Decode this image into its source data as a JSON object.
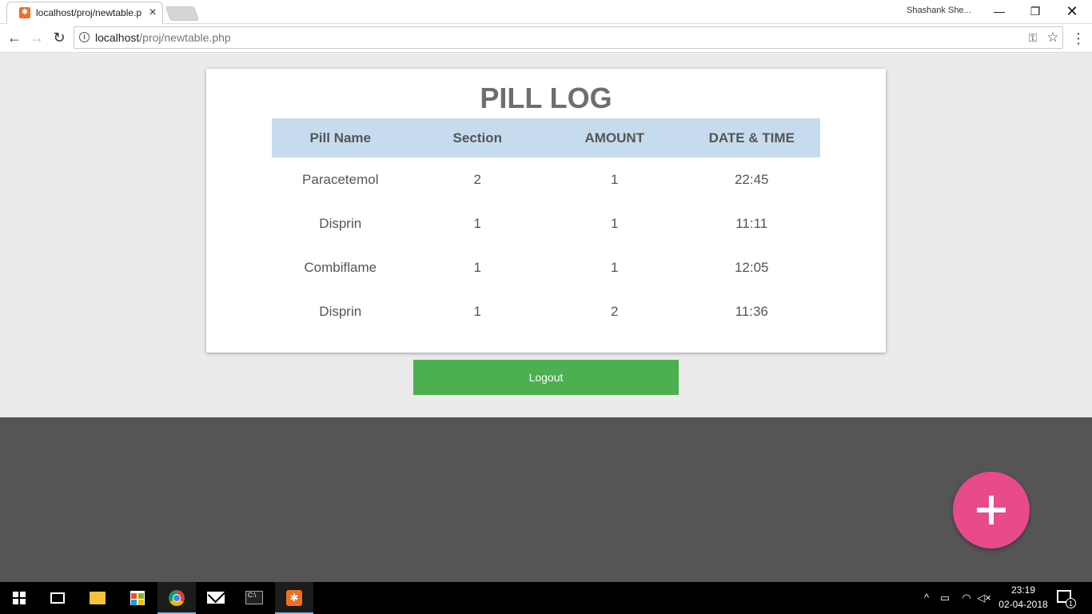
{
  "browser": {
    "tab_title": "localhost/proj/newtable.p",
    "tab_close": "×",
    "profile_name": "Shashank She...",
    "window_controls": {
      "minimize": "—",
      "maximize": "❐",
      "close": "✕"
    },
    "nav": {
      "back": "←",
      "forward": "→",
      "reload": "↻"
    },
    "url_host": "localhost",
    "url_path": "/proj/newtable.php",
    "icons": [
      "info-icon",
      "key-icon",
      "star-icon",
      "menu-icon"
    ]
  },
  "page": {
    "title": "PILL LOG",
    "table": {
      "headers": [
        "Pill Name",
        "Section",
        "AMOUNT",
        "DATE & TIME"
      ],
      "rows": [
        [
          "Paracetemol",
          "2",
          "1",
          "22:45"
        ],
        [
          "Disprin",
          "1",
          "1",
          "11:11"
        ],
        [
          "Combiflame",
          "1",
          "1",
          "12:05"
        ],
        [
          "Disprin",
          "1",
          "2",
          "11:36"
        ]
      ]
    },
    "logout_label": "Logout",
    "fab_icon": "plus-icon"
  },
  "colors": {
    "page_background": "#ebebeb",
    "table_header_bg": "#c6dcee",
    "logout_bg": "#4caf50",
    "fab_bg": "#e94a8a",
    "dark_area": "#555555"
  },
  "taskbar": {
    "apps": [
      "start-button",
      "task-view",
      "file-explorer",
      "store",
      "chrome",
      "mail",
      "command-prompt",
      "xampp"
    ],
    "tray": {
      "chevron": "^",
      "time": "23:19",
      "date": "02-04-2018",
      "notification_count": "1"
    }
  }
}
